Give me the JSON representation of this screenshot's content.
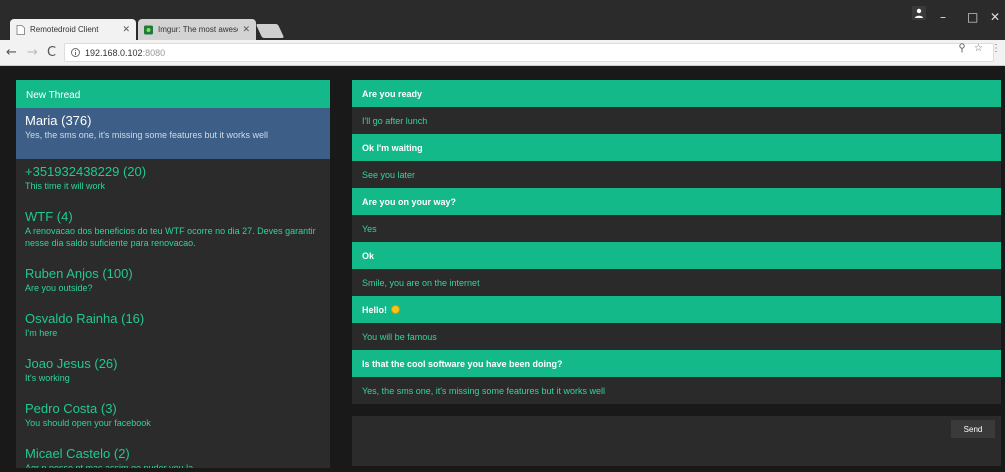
{
  "browser": {
    "tabs": [
      {
        "title": "Remotedroid Client",
        "active": true
      },
      {
        "title": "Imgur: The most awesom",
        "active": false
      }
    ],
    "url_host": "192.168.0.102",
    "url_port": ":8080",
    "window_controls": [
      "–",
      "□",
      "✕"
    ]
  },
  "sidebar": {
    "new_thread_label": "New Thread",
    "threads": [
      {
        "name": "Maria (376)",
        "preview": "Yes, the sms one, it's missing some features but it works well"
      },
      {
        "name": "+351932438229 (20)",
        "preview": "This time it will work"
      },
      {
        "name": "WTF (4)",
        "preview": "A renovacao dos beneficios do teu WTF ocorre no dia 27. Deves garantir nesse dia saldo suficiente para renovacao."
      },
      {
        "name": "Ruben Anjos (100)",
        "preview": "Are you outside?"
      },
      {
        "name": "Osvaldo Rainha (16)",
        "preview": "I'm here"
      },
      {
        "name": "Joao Jesus (26)",
        "preview": "It's working"
      },
      {
        "name": "Pedro Costa (3)",
        "preview": "You should open your facebook"
      },
      {
        "name": "Micael Castelo (2)",
        "preview": "Agr n posso pt mas assim qe puder vou la"
      }
    ]
  },
  "chat": {
    "messages": [
      {
        "text": "Are you ready",
        "mine": true
      },
      {
        "text": "I'll go after lunch",
        "mine": false
      },
      {
        "text": "Ok I'm waiting",
        "mine": true
      },
      {
        "text": "See you later",
        "mine": false
      },
      {
        "text": "Are you on your way?",
        "mine": true
      },
      {
        "text": "Yes",
        "mine": false
      },
      {
        "text": "Ok",
        "mine": true
      },
      {
        "text": "Smile, you are on the internet",
        "mine": false
      },
      {
        "text": "Hello!",
        "mine": true
      },
      {
        "text": "You will be famous",
        "mine": false
      },
      {
        "text": "Is that the cool software you have been doing?",
        "mine": true
      },
      {
        "text": "Yes, the sms one, it's missing some features but it works well",
        "mine": false
      }
    ],
    "send_label": "Send"
  },
  "colors": {
    "accent": "#14b98a",
    "selected": "#3d5e86"
  }
}
